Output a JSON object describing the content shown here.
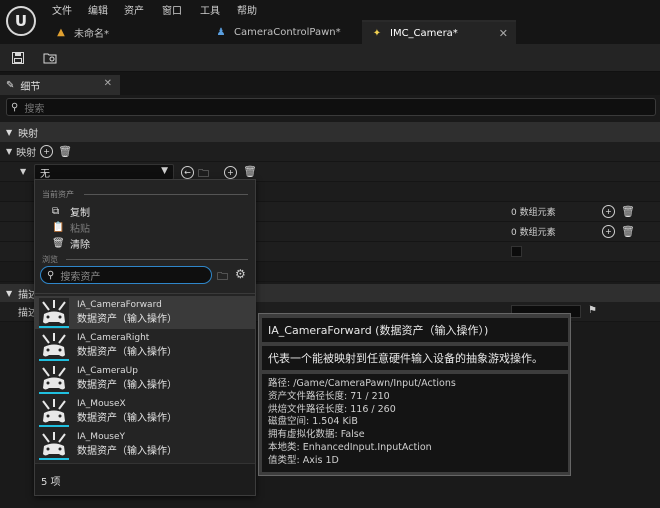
{
  "menu": [
    "文件",
    "编辑",
    "资产",
    "窗口",
    "工具",
    "帮助"
  ],
  "tabs": [
    {
      "label": "未命名*",
      "icon": "level-icon"
    },
    {
      "label": "CameraControlPawn*",
      "icon": "blueprint-icon"
    },
    {
      "label": "IMC_Camera*",
      "icon": "input-context-icon"
    }
  ],
  "details_tab": "细节",
  "search_placeholder": "搜索",
  "sections": {
    "mapping": "映射",
    "mapping_sub": "映射",
    "description": "描述"
  },
  "combo_value": "无",
  "array_count_label": "0 数组元素",
  "description_row_label": "描述",
  "dropdown": {
    "current_asset_header": "当前资产",
    "copy": "复制",
    "paste": "粘贴",
    "clear": "清除",
    "browse_header": "浏览",
    "search_placeholder": "搜索资产",
    "assets": [
      {
        "name": "IA_CameraForward",
        "type": "数据资产（输入操作）"
      },
      {
        "name": "IA_CameraRight",
        "type": "数据资产（输入操作）"
      },
      {
        "name": "IA_CameraUp",
        "type": "数据资产（输入操作）"
      },
      {
        "name": "IA_MouseX",
        "type": "数据资产（输入操作）"
      },
      {
        "name": "IA_MouseY",
        "type": "数据资产（输入操作）"
      }
    ],
    "count": "5 项"
  },
  "tooltip": {
    "title": "IA_CameraForward (数据资产（输入操作）)",
    "description": "代表一个能被映射到任意硬件输入设备的抽象游戏操作。",
    "info": [
      {
        "label": "路径:",
        "value": "/Game/CameraPawn/Input/Actions"
      },
      {
        "label": "资产文件路径长度:",
        "value": "71 / 210"
      },
      {
        "label": "烘焙文件路径长度:",
        "value": "116 / 260"
      },
      {
        "label": "磁盘空间:",
        "value": "1.504 KiB"
      },
      {
        "label": "拥有虚拟化数据:",
        "value": "False"
      },
      {
        "label": "本地类:",
        "value": "EnhancedInput.InputAction"
      },
      {
        "label": "值类型:",
        "value": "Axis 1D"
      }
    ]
  },
  "colors": {
    "accent": "#2f86c9",
    "selection_bar": "#20c0e0",
    "panel": "#1a1a1a"
  }
}
